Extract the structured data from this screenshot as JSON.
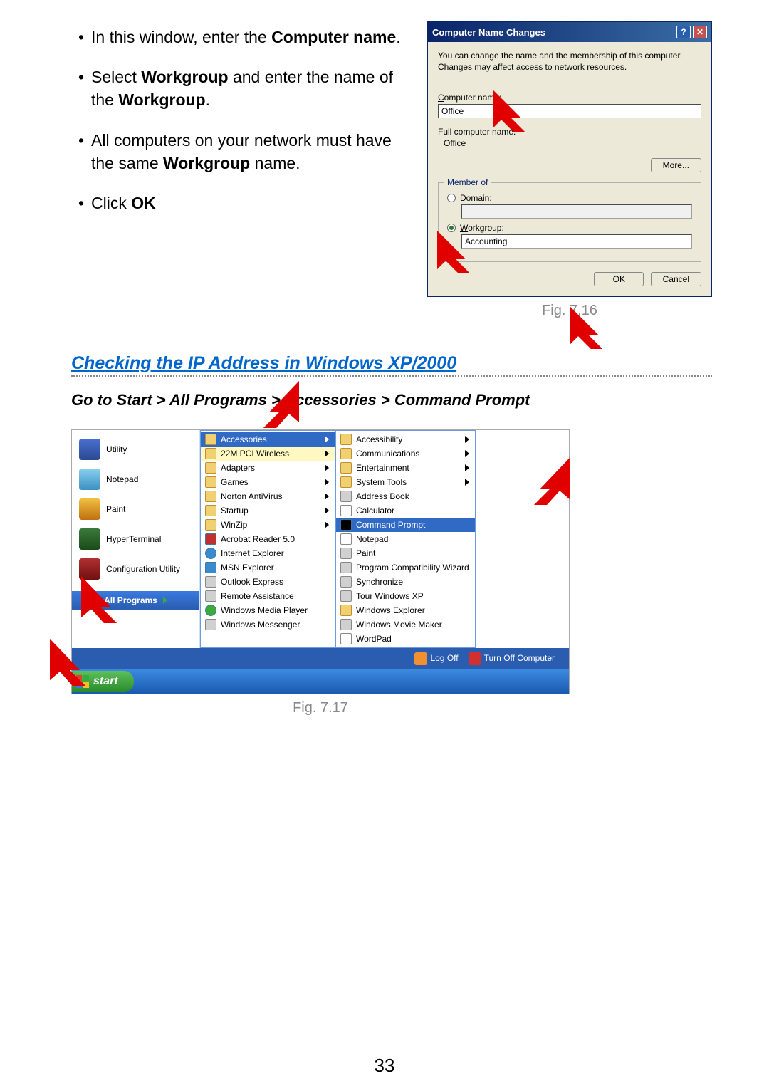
{
  "instructions": {
    "i1a": "In this window, enter the ",
    "i1b": "Computer name",
    "i1c": ".",
    "i2a": "Select ",
    "i2b": "Workgroup",
    "i2c": " and enter the name of the ",
    "i2d": "Workgroup",
    "i2e": ".",
    "i3a": "All computers on your network must have the same ",
    "i3b": "Workgroup",
    "i3c": " name.",
    "i4a": "Click ",
    "i4b": "OK"
  },
  "dialog": {
    "title": "Computer Name Changes",
    "desc": "You can change the name and the membership of this computer. Changes may affect access to network resources.",
    "computer_name_label_pre": "C",
    "computer_name_label": "omputer name:",
    "computer_name_value": "Office",
    "full_label": "Full computer name:",
    "full_value": "Office",
    "more_btn_pre": "M",
    "more_btn": "ore...",
    "group_title": "Member of",
    "domain_pre": "D",
    "domain_label": "omain:",
    "domain_value": "",
    "workgroup_pre": "W",
    "workgroup_label": "orkgroup:",
    "workgroup_value": "Accounting",
    "ok": "OK",
    "cancel": "Cancel"
  },
  "fig1": "Fig. 7.16",
  "section_title": "Checking the IP Address in Windows XP/2000",
  "subheading": "Go to Start > All Programs > Accessories > Command Prompt",
  "start": {
    "pinned": [
      "Utility",
      "Notepad",
      "Paint",
      "HyperTerminal",
      "Configuration Utility"
    ],
    "all_programs": "All Programs",
    "logoff": "Log Off",
    "turnoff": "Turn Off Computer",
    "start_btn": "start",
    "menu1": [
      {
        "label": "Accessories",
        "type": "folder",
        "sub": true,
        "hl": true
      },
      {
        "label": "22M PCI Wireless",
        "type": "folder",
        "sub": true,
        "sel": true
      },
      {
        "label": "Adapters",
        "type": "folder",
        "sub": true
      },
      {
        "label": "Games",
        "type": "folder",
        "sub": true
      },
      {
        "label": "Norton AntiVirus",
        "type": "folder",
        "sub": true
      },
      {
        "label": "Startup",
        "type": "folder",
        "sub": true
      },
      {
        "label": "WinZip",
        "type": "folder",
        "sub": true
      },
      {
        "label": "Acrobat Reader 5.0",
        "type": "acr"
      },
      {
        "label": "Internet Explorer",
        "type": "ie"
      },
      {
        "label": "MSN Explorer",
        "type": "msn"
      },
      {
        "label": "Outlook Express",
        "type": "app"
      },
      {
        "label": "Remote Assistance",
        "type": "app"
      },
      {
        "label": "Windows Media Player",
        "type": "wmp"
      },
      {
        "label": "Windows Messenger",
        "type": "app"
      }
    ],
    "menu2": [
      {
        "label": "Accessibility",
        "type": "folder",
        "sub": true
      },
      {
        "label": "Communications",
        "type": "folder",
        "sub": true
      },
      {
        "label": "Entertainment",
        "type": "folder",
        "sub": true
      },
      {
        "label": "System Tools",
        "type": "folder",
        "sub": true
      },
      {
        "label": "Address Book",
        "type": "app"
      },
      {
        "label": "Calculator",
        "type": "pg"
      },
      {
        "label": "Command Prompt",
        "type": "cmd",
        "hl": true
      },
      {
        "label": "Notepad",
        "type": "pg"
      },
      {
        "label": "Paint",
        "type": "app"
      },
      {
        "label": "Program Compatibility Wizard",
        "type": "app"
      },
      {
        "label": "Synchronize",
        "type": "app"
      },
      {
        "label": "Tour Windows XP",
        "type": "app"
      },
      {
        "label": "Windows Explorer",
        "type": "folder"
      },
      {
        "label": "Windows Movie Maker",
        "type": "app"
      },
      {
        "label": "WordPad",
        "type": "pg"
      }
    ]
  },
  "fig2": "Fig. 7.17",
  "page_number": "33"
}
